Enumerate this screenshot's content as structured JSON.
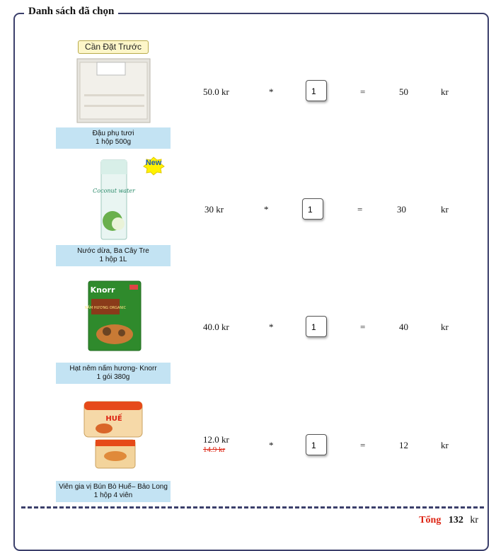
{
  "section": {
    "title": "Danh sách đã chọn"
  },
  "items": [
    {
      "badge": "Cần Đặt Trước",
      "name": "Đậu phụ tươi",
      "pack": "1 hộp 500g",
      "price": "50.0 kr",
      "old_price": "",
      "times": "*",
      "qty": "1",
      "equals": "=",
      "subtotal": "50",
      "currency": "kr"
    },
    {
      "badge": "New",
      "name": "Nước dừa, Ba Cây Tre",
      "pack": "1 hộp 1L",
      "price": "30 kr",
      "old_price": "",
      "times": "*",
      "qty": "1",
      "equals": "=",
      "subtotal": "30",
      "currency": "kr"
    },
    {
      "badge": "",
      "name": "Hạt nêm nấm hương- Knorr",
      "pack": "1 gói 380g",
      "price": "40.0 kr",
      "old_price": "",
      "times": "*",
      "qty": "1",
      "equals": "=",
      "subtotal": "40",
      "currency": "kr"
    },
    {
      "badge": "",
      "name": "Viên gia vị Bún Bò Huế– Bảo Long",
      "pack": "1 hộp 4 viên",
      "price": "12.0 kr",
      "old_price": "14.9 kr",
      "times": "*",
      "qty": "1",
      "equals": "=",
      "subtotal": "12",
      "currency": "kr"
    }
  ],
  "product_art": {
    "coconut_brand": "Coconut water",
    "knorr_brand": "Knorr",
    "knorr_sub": "NẤM HƯƠNG ORGANIC",
    "hue_brand": "HUẾ"
  },
  "total": {
    "label": "Tổng",
    "amount": "132",
    "currency": "kr"
  },
  "colors": {
    "accent_red": "#dd2211",
    "caption_bg": "#c3e3f3",
    "border_navy": "#3b3f6b"
  }
}
